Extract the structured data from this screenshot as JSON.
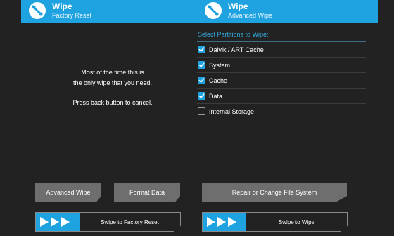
{
  "colors": {
    "accent": "#1fa3e0",
    "background": "#222222",
    "button": "#6e6e6e"
  },
  "left": {
    "header": {
      "title": "Wipe",
      "subtitle": "Factory Reset",
      "icon": "twrp-logo-icon"
    },
    "info": {
      "line1": "Most of the time this is",
      "line2": "the only wipe that you need.",
      "line3": "Press back button to cancel."
    },
    "buttons": {
      "advanced_wipe": "Advanced Wipe",
      "format_data": "Format Data"
    },
    "swipe": {
      "label": "Swipe to Factory Reset"
    }
  },
  "right": {
    "header": {
      "title": "Wipe",
      "subtitle": "Advanced Wipe",
      "icon": "twrp-logo-icon"
    },
    "partitions": {
      "title": "Select Partitions to Wipe:",
      "items": [
        {
          "label": "Dalvik / ART Cache",
          "checked": true
        },
        {
          "label": "System",
          "checked": true
        },
        {
          "label": "Cache",
          "checked": true
        },
        {
          "label": "Data",
          "checked": true
        },
        {
          "label": "Internal Storage",
          "checked": false
        }
      ]
    },
    "buttons": {
      "repair": "Repair or Change File System"
    },
    "swipe": {
      "label": "Swipe to Wipe"
    }
  }
}
